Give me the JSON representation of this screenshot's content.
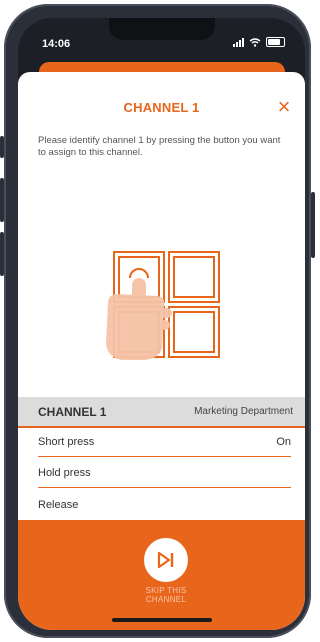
{
  "status": {
    "time": "14:06"
  },
  "modal": {
    "title": "CHANNEL 1",
    "close_icon": "×",
    "instructions": "Please identify channel 1 by pressing the button you want to assign to this channel."
  },
  "table": {
    "header_title": "CHANNEL 1",
    "header_value": "Marketing Department",
    "rows": [
      {
        "label": "Short press",
        "value": "On"
      },
      {
        "label": "Hold press",
        "value": ""
      },
      {
        "label": "Release",
        "value": ""
      }
    ]
  },
  "footer": {
    "skip_label_line1": "SKIP THIS",
    "skip_label_line2": "CHANNEL"
  },
  "colors": {
    "accent": "#e8661c",
    "header_bg": "#dcdcdc",
    "hand": "#f5c2a6"
  }
}
